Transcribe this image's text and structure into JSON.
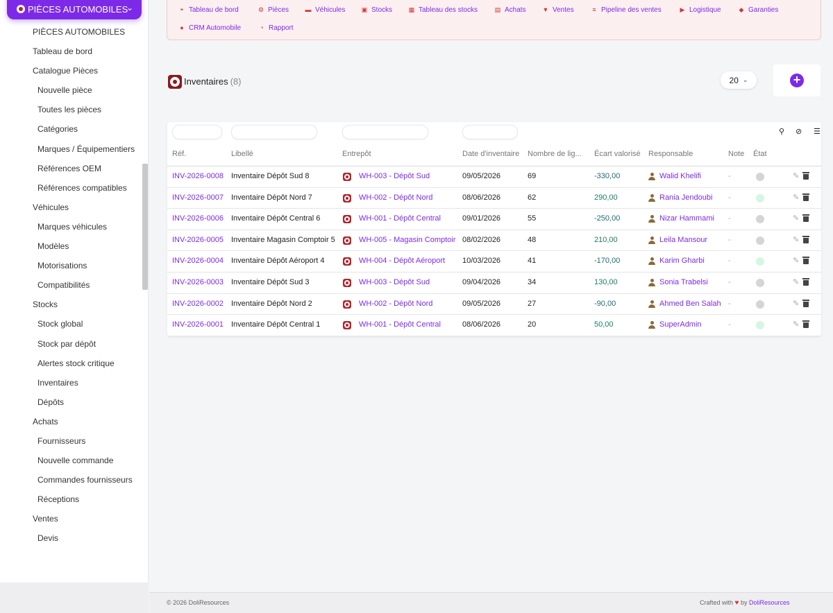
{
  "module": {
    "label": "PIÈCES AUTOMOBILES"
  },
  "sidebar": {
    "items": [
      {
        "label": "PIÈCES AUTOMOBILES",
        "level": 1
      },
      {
        "label": "Tableau de bord",
        "level": 1
      },
      {
        "label": "Catalogue Pièces",
        "level": 1
      },
      {
        "label": "Nouvelle pièce",
        "level": 2
      },
      {
        "label": "Toutes les pièces",
        "level": 2
      },
      {
        "label": "Catégories",
        "level": 2
      },
      {
        "label": "Marques / Équipementiers",
        "level": 2
      },
      {
        "label": "Références OEM",
        "level": 2
      },
      {
        "label": "Références compatibles",
        "level": 2
      },
      {
        "label": "Véhicules",
        "level": 1
      },
      {
        "label": "Marques véhicules",
        "level": 2
      },
      {
        "label": "Modèles",
        "level": 2
      },
      {
        "label": "Motorisations",
        "level": 2
      },
      {
        "label": "Compatibilités",
        "level": 2
      },
      {
        "label": "Stocks",
        "level": 1
      },
      {
        "label": "Stock global",
        "level": 2
      },
      {
        "label": "Stock par dépôt",
        "level": 2
      },
      {
        "label": "Alertes stock critique",
        "level": 2
      },
      {
        "label": "Inventaires",
        "level": 2
      },
      {
        "label": "Dépôts",
        "level": 2
      },
      {
        "label": "Achats",
        "level": 1
      },
      {
        "label": "Fournisseurs",
        "level": 2
      },
      {
        "label": "Nouvelle commande",
        "level": 2
      },
      {
        "label": "Commandes fournisseurs",
        "level": 2
      },
      {
        "label": "Réceptions",
        "level": 2
      },
      {
        "label": "Ventes",
        "level": 1
      },
      {
        "label": "Devis",
        "level": 2
      }
    ]
  },
  "topnav": {
    "items": [
      {
        "label": "Tableau de bord",
        "icon": "gauge-icon"
      },
      {
        "label": "Pièces",
        "icon": "gear-icon"
      },
      {
        "label": "Véhicules",
        "icon": "car-icon"
      },
      {
        "label": "Stocks",
        "icon": "boxes-icon"
      },
      {
        "label": "Tableau des stocks",
        "icon": "grid-icon"
      },
      {
        "label": "Achats",
        "icon": "receipt-icon"
      },
      {
        "label": "Ventes",
        "icon": "cart-icon"
      },
      {
        "label": "Pipeline des ventes",
        "icon": "pipeline-icon"
      },
      {
        "label": "Logistique",
        "icon": "truck-icon"
      },
      {
        "label": "Garanties",
        "icon": "shield-icon"
      },
      {
        "label": "CRM Automobile",
        "icon": "user-plus-icon"
      },
      {
        "label": "Rapport",
        "icon": "pie-chart-icon"
      }
    ]
  },
  "page": {
    "title": "Inventaires",
    "count": "(8)",
    "limit": "20"
  },
  "table": {
    "columns": [
      "Réf.",
      "Libellé",
      "Entrepôt",
      "Date d'inventaire",
      "Nombre de lig...",
      "Écart valorisé",
      "Responsable",
      "Note",
      "État"
    ],
    "rows": [
      {
        "ref": "INV-2026-0008",
        "label": "Inventaire Dépôt Sud 8",
        "warehouse": "WH-003 - Dépôt Sud",
        "date": "09/05/2026",
        "lines": "69",
        "ecart": "-330,00",
        "user": "Walid Khelifi",
        "note": "-",
        "status": "grey"
      },
      {
        "ref": "INV-2026-0007",
        "label": "Inventaire Dépôt Nord 7",
        "warehouse": "WH-002 - Dépôt Nord",
        "date": "08/06/2026",
        "lines": "62",
        "ecart": "290,00",
        "user": "Rania Jendoubi",
        "note": "-",
        "status": "green"
      },
      {
        "ref": "INV-2026-0006",
        "label": "Inventaire Dépôt Central 6",
        "warehouse": "WH-001 - Dépôt Central",
        "date": "09/01/2026",
        "lines": "55",
        "ecart": "-250,00",
        "user": "Nizar Hammami",
        "note": "-",
        "status": "grey"
      },
      {
        "ref": "INV-2026-0005",
        "label": "Inventaire Magasin Comptoir 5",
        "warehouse": "WH-005 - Magasin Comptoir",
        "date": "08/02/2026",
        "lines": "48",
        "ecart": "210,00",
        "user": "Leila Mansour",
        "note": "-",
        "status": "grey"
      },
      {
        "ref": "INV-2026-0004",
        "label": "Inventaire Dépôt Aéroport 4",
        "warehouse": "WH-004 - Dépôt Aéroport",
        "date": "10/03/2026",
        "lines": "41",
        "ecart": "-170,00",
        "user": "Karim Gharbi",
        "note": "-",
        "status": "green"
      },
      {
        "ref": "INV-2026-0003",
        "label": "Inventaire Dépôt Sud 3",
        "warehouse": "WH-003 - Dépôt Sud",
        "date": "09/04/2026",
        "lines": "34",
        "ecart": "130,00",
        "user": "Sonia Trabelsi",
        "note": "-",
        "status": "grey"
      },
      {
        "ref": "INV-2026-0002",
        "label": "Inventaire Dépôt Nord 2",
        "warehouse": "WH-002 - Dépôt Nord",
        "date": "09/05/2026",
        "lines": "27",
        "ecart": "-90,00",
        "user": "Ahmed Ben Salah",
        "note": "-",
        "status": "grey"
      },
      {
        "ref": "INV-2026-0001",
        "label": "Inventaire Dépôt Central 1",
        "warehouse": "WH-001 - Dépôt Central",
        "date": "08/06/2026",
        "lines": "20",
        "ecart": "50,00",
        "user": "SuperAdmin",
        "note": "-",
        "status": "green"
      }
    ]
  },
  "colors": {
    "accent": "#7d2ae8",
    "status_grey": "#d5d5d8",
    "status_green": "#d3f7e4",
    "positive": "#1d7a69"
  },
  "footer": {
    "copyright": "© 2026 DoliResources",
    "crafted": "Crafted with",
    "by": "by",
    "brand": "DoliResources"
  }
}
